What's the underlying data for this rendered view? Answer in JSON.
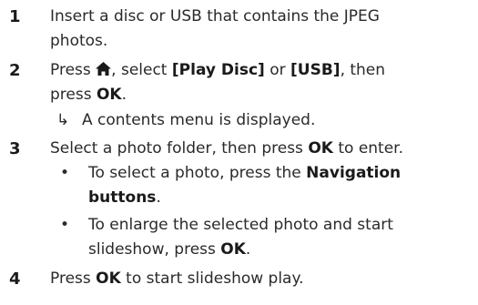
{
  "steps": [
    {
      "number": "1",
      "line1": "Insert a disc or USB that contains the JPEG",
      "line2": "photos."
    },
    {
      "number": "2",
      "line1_pre": "Press ",
      "line1_mid": ", select ",
      "play_disc": "[Play Disc]",
      "or": " or ",
      "usb": "[USB]",
      "line1_post": ", then",
      "line2_pre": "press ",
      "ok": "OK",
      "line2_post": ".",
      "result_arrow": "↳",
      "result": "A contents menu is displayed.",
      "icon": "home-icon"
    },
    {
      "number": "3",
      "line1_pre": "Select a photo folder, then press ",
      "ok": "OK",
      "line1_post": " to enter.",
      "bullets": [
        {
          "marker": "•",
          "line1_pre": "To select a photo, press the ",
          "line1_bold": "Navigation",
          "line2_bold": "buttons",
          "line2_post": "."
        },
        {
          "marker": "•",
          "line1": "To enlarge the selected photo and start",
          "line2_pre": "slideshow, press ",
          "line2_bold": "OK",
          "line2_post": "."
        }
      ]
    },
    {
      "number": "4",
      "line1_pre": "Press ",
      "ok": "OK",
      "line1_post": " to start slideshow play."
    }
  ]
}
